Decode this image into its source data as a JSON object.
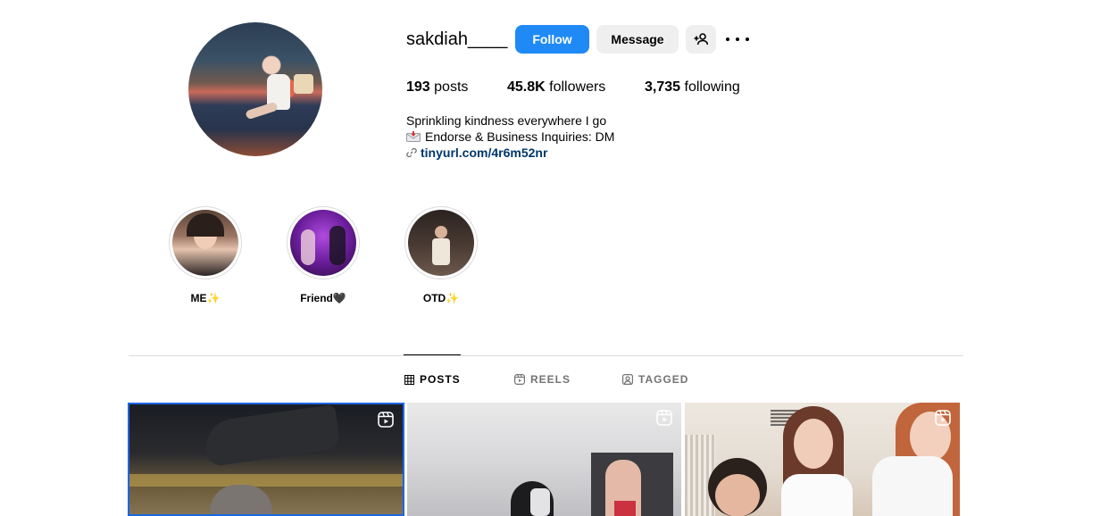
{
  "profile": {
    "username": "sakdiah____",
    "follow_label": "Follow",
    "message_label": "Message",
    "stats": {
      "posts_count": "193",
      "posts_label": "posts",
      "followers_count": "45.8K",
      "followers_label": "followers",
      "following_count": "3,735",
      "following_label": "following"
    },
    "bio": {
      "line1": "Sprinkling kindness everywhere I go",
      "line2": "Endorse & Business Inquiries: DM",
      "link": "tinyurl.com/4r6m52nr"
    }
  },
  "highlights": [
    {
      "label": "ME✨"
    },
    {
      "label": "Friend🖤"
    },
    {
      "label": "OTD✨"
    }
  ],
  "tabs": [
    {
      "label": "POSTS",
      "active": true
    },
    {
      "label": "REELS",
      "active": false
    },
    {
      "label": "TAGGED",
      "active": false
    }
  ],
  "icons": {
    "add_user": "person-add-icon",
    "more": "more-options-icon",
    "link": "link-icon",
    "mail": "incoming-mail-icon",
    "reel": "reel-icon",
    "grid": "grid-icon",
    "tagged": "tagged-icon"
  },
  "colors": {
    "follow_button": "#1f8af5",
    "secondary_button": "#efefef",
    "link": "#00376b",
    "selected_post_border": "#1e66e6"
  }
}
